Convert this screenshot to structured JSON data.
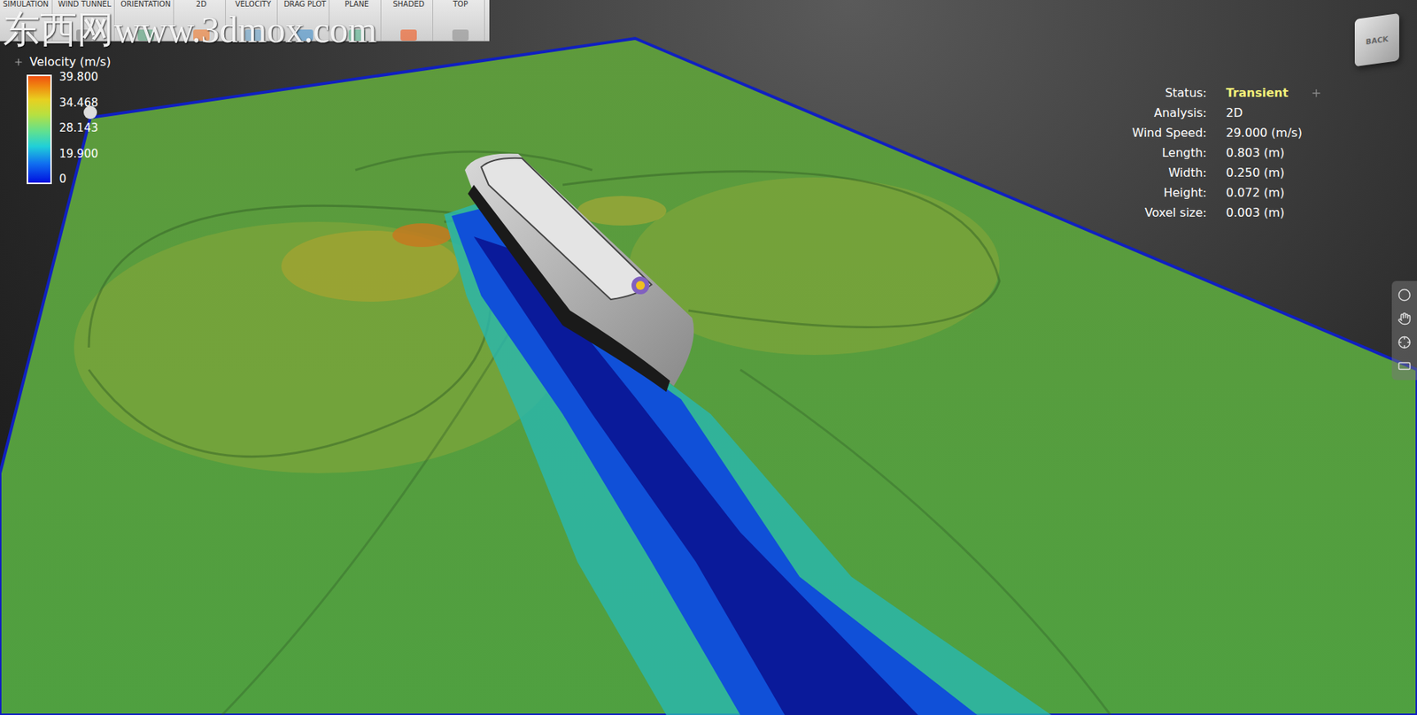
{
  "toolbar": {
    "items": [
      {
        "label": "SIMULATION"
      },
      {
        "label": "WIND TUNNEL"
      },
      {
        "label": "ORIENTATION"
      },
      {
        "label": "2D"
      },
      {
        "label": "VELOCITY"
      },
      {
        "label": "DRAG PLOT"
      },
      {
        "label": "PLANE"
      },
      {
        "label": "SHADED"
      },
      {
        "label": "TOP"
      }
    ]
  },
  "watermark": "东西网www.3dmox.com",
  "legend": {
    "title": "Velocity (m/s)",
    "ticks": [
      "39.800",
      "34.468",
      "28.143",
      "19.900",
      "0"
    ]
  },
  "info": [
    {
      "label": "Status:",
      "value": "Transient",
      "highlight": true
    },
    {
      "label": "Analysis:",
      "value": "2D",
      "highlight": false
    },
    {
      "label": "Wind Speed:",
      "value": "29.000 (m/s)",
      "highlight": false
    },
    {
      "label": "Length:",
      "value": "0.803 (m)",
      "highlight": false
    },
    {
      "label": "Width:",
      "value": "0.250 (m)",
      "highlight": false
    },
    {
      "label": "Height:",
      "value": "0.072 (m)",
      "highlight": false
    },
    {
      "label": "Voxel size:",
      "value": "0.003 (m)",
      "highlight": false
    }
  ],
  "view_cube": {
    "label": "BACK"
  }
}
